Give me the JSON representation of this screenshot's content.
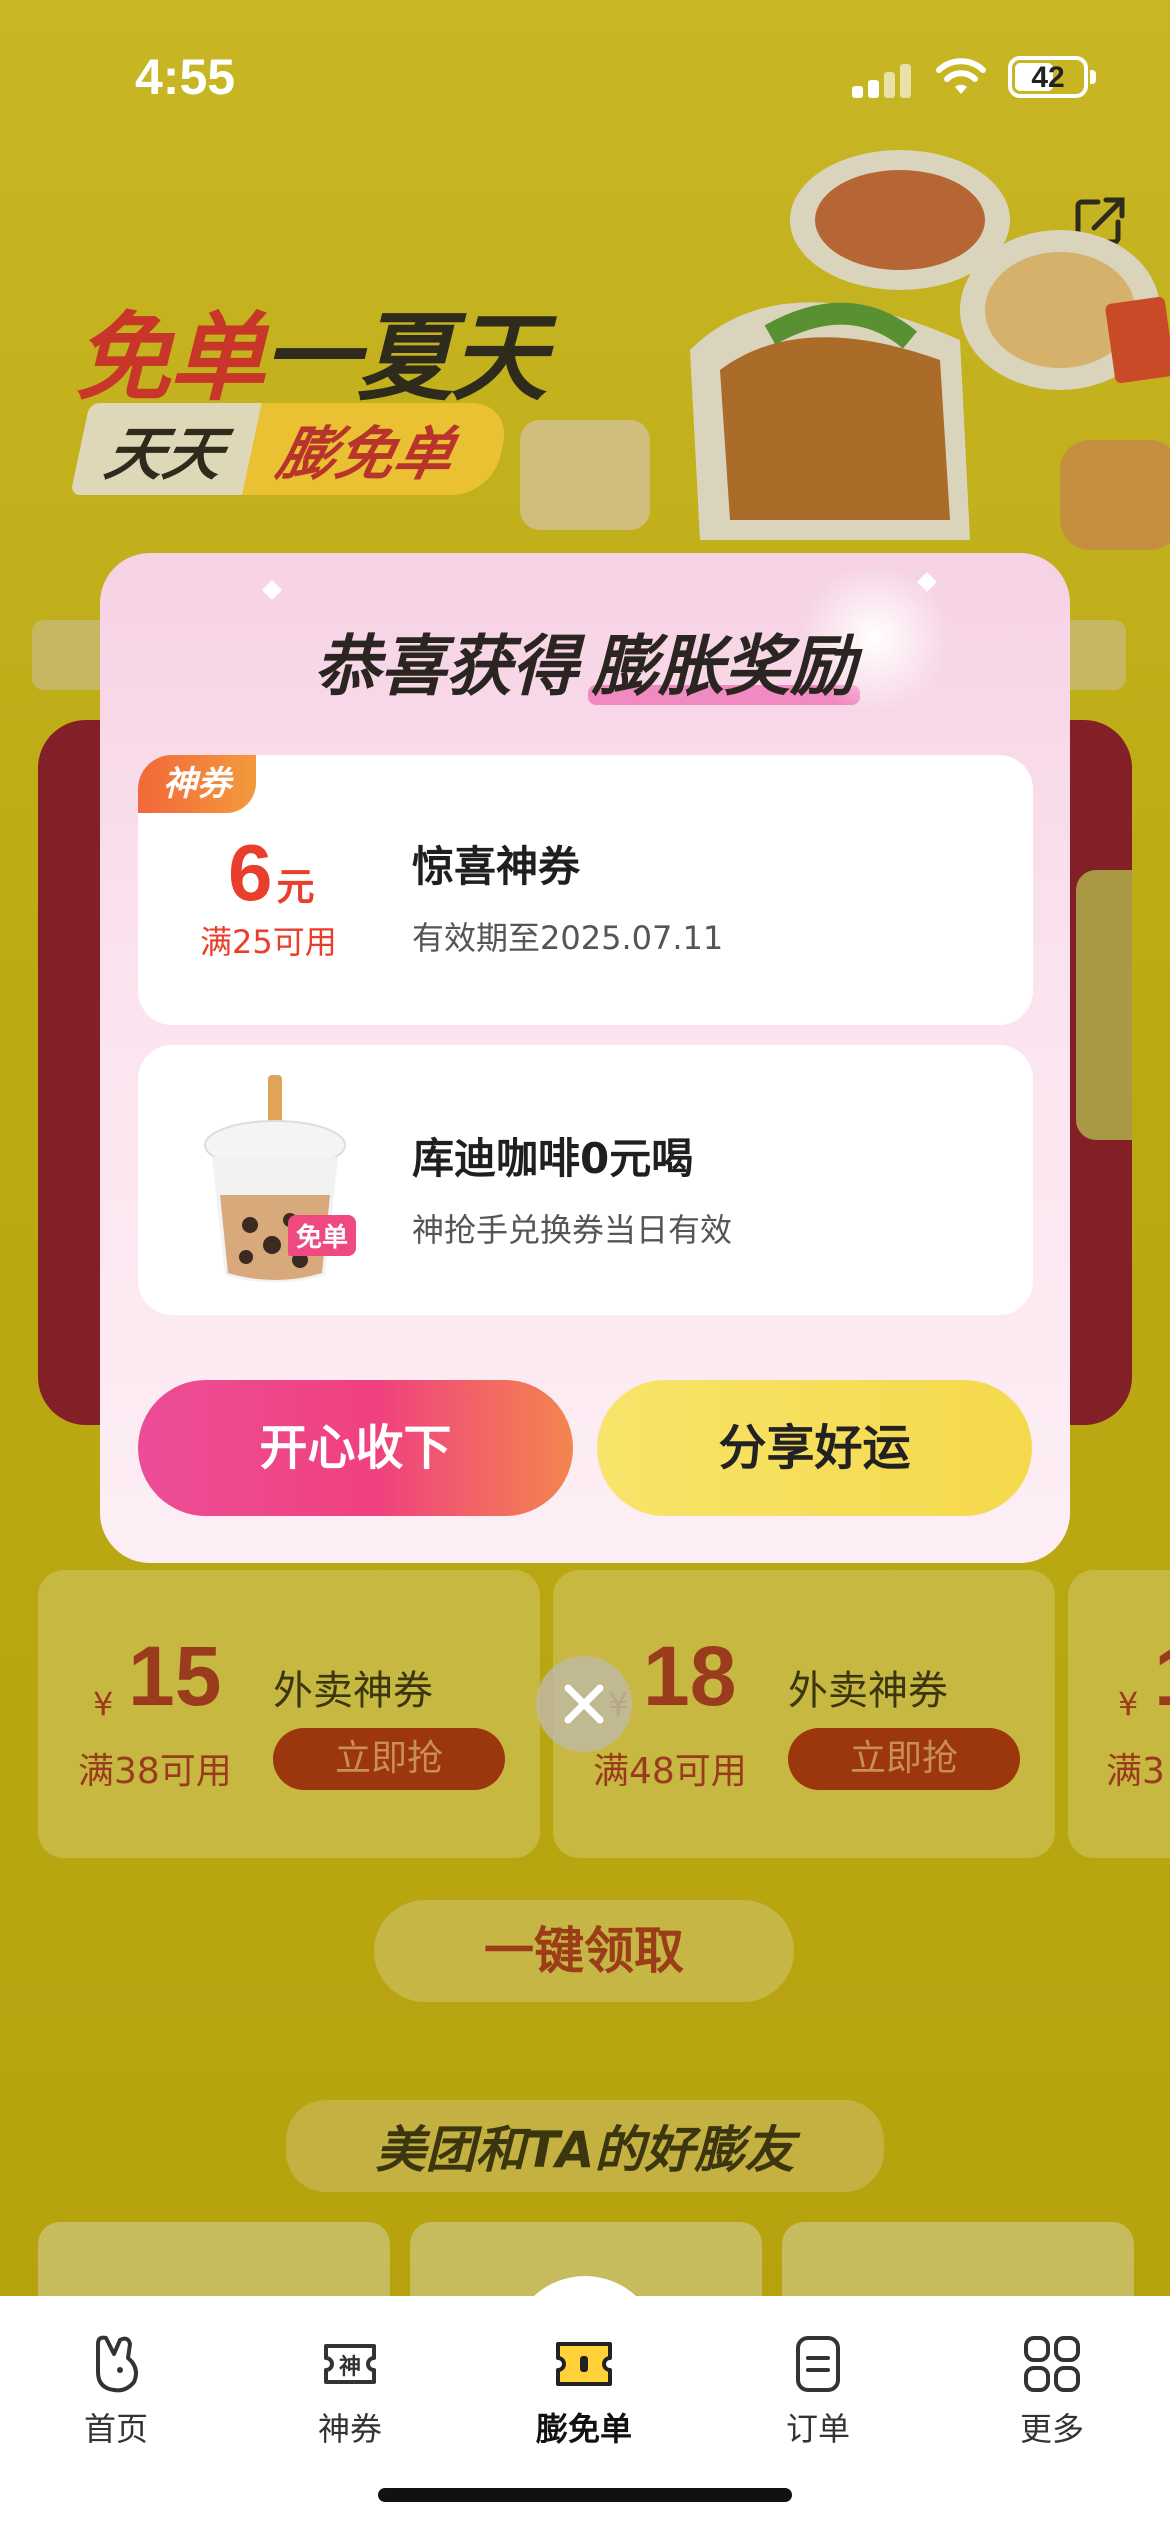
{
  "status_bar": {
    "time": "4:55",
    "battery": "42"
  },
  "banner": {
    "title_red": "免单",
    "title_dark": "一夏天",
    "sub_left": "天天",
    "sub_right": "膨免单"
  },
  "modal": {
    "title_plain": "恭喜获得",
    "title_highlight": "膨胀奖励",
    "reward1": {
      "tag": "神券",
      "amount": "6",
      "unit": "元",
      "condition": "满25可用",
      "title": "惊喜神券",
      "subtitle": "有效期至2025.07.11"
    },
    "reward2": {
      "badge": "免单",
      "title": "库迪咖啡0元喝",
      "subtitle": "神抢手兑换券当日有效"
    },
    "accept_label": "开心收下",
    "share_label": "分享好运"
  },
  "coupons": [
    {
      "currency": "¥",
      "amount": "15",
      "condition": "满38可用",
      "name": "外卖神券",
      "action": "立即抢"
    },
    {
      "currency": "¥",
      "amount": "18",
      "condition": "满48可用",
      "name": "外卖神券",
      "action": "立即抢"
    },
    {
      "currency": "¥",
      "amount": "1",
      "condition": "满3"
    }
  ],
  "one_key_label": "一键领取",
  "friends_title": "美团和TA的好膨友",
  "tabbar": {
    "items": [
      {
        "label": "首页",
        "icon": "home-icon"
      },
      {
        "label": "神券",
        "icon": "coupon-icon"
      },
      {
        "label": "膨免单",
        "icon": "free-order-icon"
      },
      {
        "label": "订单",
        "icon": "orders-icon"
      },
      {
        "label": "更多",
        "icon": "more-icon"
      }
    ]
  },
  "colors": {
    "accent_pink": "#ec4d97",
    "accent_yellow": "#f5d94c",
    "coupon_red": "#ea3e2c"
  }
}
